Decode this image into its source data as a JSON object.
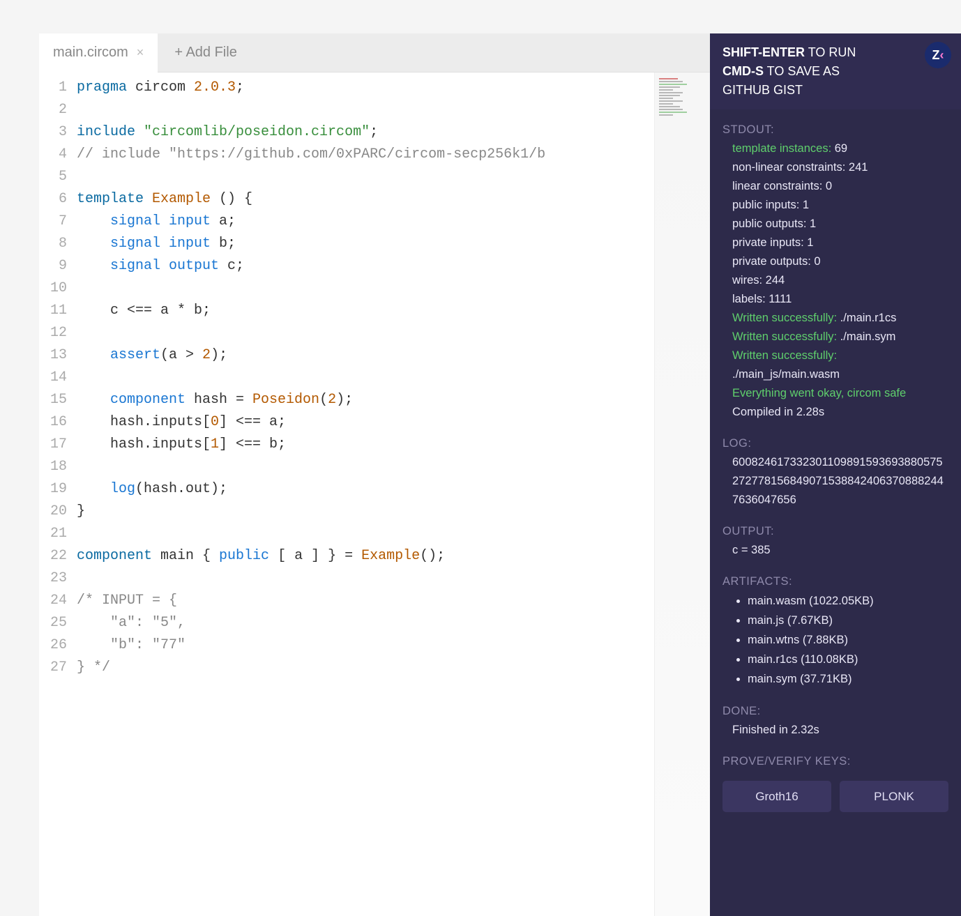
{
  "tabs": {
    "active": "main.circom",
    "add_label": "+ Add File"
  },
  "code_lines": [
    {
      "n": 1,
      "tokens": [
        {
          "t": "pragma ",
          "c": "kw"
        },
        {
          "t": "circom ",
          "c": "id"
        },
        {
          "t": "2.0.3",
          "c": "num"
        },
        {
          "t": ";",
          "c": "id"
        }
      ]
    },
    {
      "n": 2,
      "tokens": []
    },
    {
      "n": 3,
      "tokens": [
        {
          "t": "include ",
          "c": "kw"
        },
        {
          "t": "\"circomlib/poseidon.circom\"",
          "c": "str"
        },
        {
          "t": ";",
          "c": "id"
        }
      ]
    },
    {
      "n": 4,
      "tokens": [
        {
          "t": "// include \"https://github.com/0xPARC/circom-secp256k1/b",
          "c": "cmt"
        }
      ]
    },
    {
      "n": 5,
      "tokens": []
    },
    {
      "n": 6,
      "tokens": [
        {
          "t": "template ",
          "c": "kw"
        },
        {
          "t": "Example ",
          "c": "fn"
        },
        {
          "t": "() {",
          "c": "id"
        }
      ]
    },
    {
      "n": 7,
      "tokens": [
        {
          "t": "    signal input ",
          "c": "kw2"
        },
        {
          "t": "a;",
          "c": "id"
        }
      ]
    },
    {
      "n": 8,
      "tokens": [
        {
          "t": "    signal input ",
          "c": "kw2"
        },
        {
          "t": "b;",
          "c": "id"
        }
      ]
    },
    {
      "n": 9,
      "tokens": [
        {
          "t": "    signal output ",
          "c": "kw2"
        },
        {
          "t": "c;",
          "c": "id"
        }
      ]
    },
    {
      "n": 10,
      "tokens": []
    },
    {
      "n": 11,
      "tokens": [
        {
          "t": "    c <== a * b;",
          "c": "id"
        }
      ]
    },
    {
      "n": 12,
      "tokens": []
    },
    {
      "n": 13,
      "tokens": [
        {
          "t": "    assert",
          "c": "kw2"
        },
        {
          "t": "(a > ",
          "c": "id"
        },
        {
          "t": "2",
          "c": "num"
        },
        {
          "t": ");",
          "c": "id"
        }
      ]
    },
    {
      "n": 14,
      "tokens": []
    },
    {
      "n": 15,
      "tokens": [
        {
          "t": "    component ",
          "c": "kw2"
        },
        {
          "t": "hash = ",
          "c": "id"
        },
        {
          "t": "Poseidon",
          "c": "fn"
        },
        {
          "t": "(",
          "c": "id"
        },
        {
          "t": "2",
          "c": "num"
        },
        {
          "t": ");",
          "c": "id"
        }
      ]
    },
    {
      "n": 16,
      "tokens": [
        {
          "t": "    hash.inputs[",
          "c": "id"
        },
        {
          "t": "0",
          "c": "num"
        },
        {
          "t": "] <== a;",
          "c": "id"
        }
      ]
    },
    {
      "n": 17,
      "tokens": [
        {
          "t": "    hash.inputs[",
          "c": "id"
        },
        {
          "t": "1",
          "c": "num"
        },
        {
          "t": "] <== b;",
          "c": "id"
        }
      ]
    },
    {
      "n": 18,
      "tokens": []
    },
    {
      "n": 19,
      "tokens": [
        {
          "t": "    log",
          "c": "kw2"
        },
        {
          "t": "(hash.out);",
          "c": "id"
        }
      ]
    },
    {
      "n": 20,
      "tokens": [
        {
          "t": "}",
          "c": "id"
        }
      ]
    },
    {
      "n": 21,
      "tokens": []
    },
    {
      "n": 22,
      "tokens": [
        {
          "t": "component ",
          "c": "kw"
        },
        {
          "t": "main { ",
          "c": "id"
        },
        {
          "t": "public ",
          "c": "kw2"
        },
        {
          "t": "[ a ] } = ",
          "c": "id"
        },
        {
          "t": "Example",
          "c": "fn"
        },
        {
          "t": "();",
          "c": "id"
        }
      ]
    },
    {
      "n": 23,
      "tokens": []
    },
    {
      "n": 24,
      "tokens": [
        {
          "t": "/* INPUT = {",
          "c": "cmt"
        }
      ]
    },
    {
      "n": 25,
      "tokens": [
        {
          "t": "    \"a\": \"5\",",
          "c": "cmt"
        }
      ]
    },
    {
      "n": 26,
      "tokens": [
        {
          "t": "    \"b\": \"77\"",
          "c": "cmt"
        }
      ]
    },
    {
      "n": 27,
      "tokens": [
        {
          "t": "} */",
          "c": "cmt"
        }
      ]
    }
  ],
  "header": {
    "run_key": "SHIFT-ENTER",
    "run_rest": " TO RUN",
    "save_key": "CMD-S",
    "save_rest": " TO SAVE AS",
    "save_line3": "GITHUB GIST"
  },
  "stdout": {
    "label": "STDOUT:",
    "lines": [
      {
        "a": "template instances: ",
        "b": "69",
        "ag": true
      },
      {
        "a": "non-linear constraints: 241"
      },
      {
        "a": "linear constraints: 0"
      },
      {
        "a": "public inputs: 1"
      },
      {
        "a": "public outputs: 1"
      },
      {
        "a": "private inputs: 1"
      },
      {
        "a": "private outputs: 0"
      },
      {
        "a": "wires: 244"
      },
      {
        "a": "labels: 1111"
      },
      {
        "a": "Written successfully: ",
        "b": "./main.r1cs",
        "ag": true
      },
      {
        "a": "Written successfully: ",
        "b": "./main.sym",
        "ag": true
      },
      {
        "a": "Written successfully:",
        "ag": true
      },
      {
        "a": "./main_js/main.wasm"
      },
      {
        "a": "Everything went okay, circom safe",
        "ag": true
      },
      {
        "a": "Compiled in 2.28s"
      }
    ]
  },
  "log": {
    "label": "LOG:",
    "value": "6008246173323011098915936938805752727781568490715388424063708882447636047656"
  },
  "output": {
    "label": "OUTPUT:",
    "value": "c = 385"
  },
  "artifacts": {
    "label": "ARTIFACTS:",
    "items": [
      "main.wasm (1022.05KB)",
      "main.js (7.67KB)",
      "main.wtns (7.88KB)",
      "main.r1cs (110.08KB)",
      "main.sym (37.71KB)"
    ]
  },
  "done": {
    "label": "DONE:",
    "value": "Finished in 2.32s"
  },
  "prove": {
    "label": "PROVE/VERIFY KEYS:",
    "groth": "Groth16",
    "plonk": "PLONK"
  }
}
